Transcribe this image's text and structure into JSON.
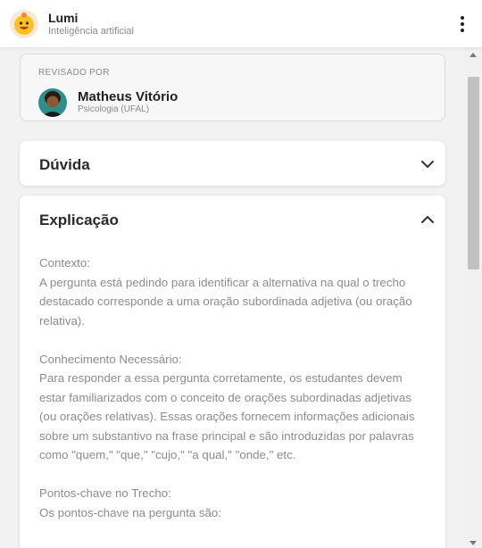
{
  "header": {
    "app_name": "Lumi",
    "app_subtitle": "Inteligência artificial",
    "logo_icon": "lumi-mascot-icon",
    "menu_icon": "kebab-menu-icon"
  },
  "reviewer": {
    "label": "REVISADO POR",
    "name": "Matheus Vitório",
    "role": "Psicologia (UFAL)"
  },
  "sections": {
    "duvida": {
      "title": "Dúvida",
      "state": "collapsed"
    },
    "explicacao": {
      "title": "Explicação",
      "state": "expanded",
      "context_heading": "Contexto:",
      "context_text": "A pergunta está pedindo para identificar a alternativa na qual o trecho destacado corresponde a uma oração subordinada adjetiva (ou oração relativa).",
      "knowledge_heading": "Conhecimento Necessário:",
      "knowledge_text": "Para responder a essa pergunta corretamente, os estudantes devem estar familiarizados com o conceito de orações subordinadas adjetivas (ou orações relativas). Essas orações fornecem informações adicionais sobre um substantivo na frase principal e são introduzidas por palavras como \"quem,\" \"que,\" \"cujo,\" \"a qual,\" \"onde,\" etc.",
      "keypoints_heading": "Pontos-chave no Trecho:",
      "keypoints_text": "Os pontos-chave na pergunta são:"
    }
  },
  "colors": {
    "background": "#f2f2f2",
    "card": "#ffffff",
    "logo_yellow": "#f9c31a",
    "muted_text": "#8c8c8c"
  }
}
